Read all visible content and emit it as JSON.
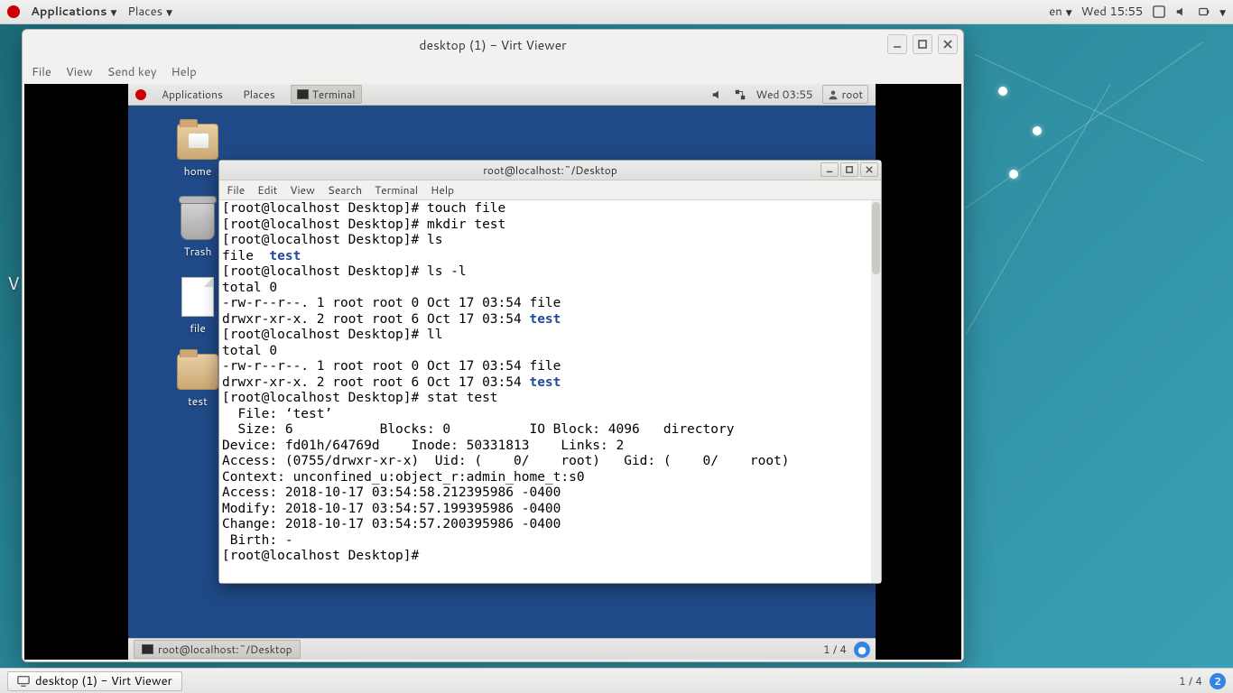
{
  "host_panel": {
    "app_menu": "Applications",
    "places_menu": "Places",
    "lang": "en",
    "clock": "Wed 15:55"
  },
  "host_bottom": {
    "task_label": "desktop (1) - Virt Viewer",
    "pager": "1 / 4",
    "badge": "2"
  },
  "virt": {
    "title": "desktop (1) - Virt Viewer",
    "menus": {
      "file": "File",
      "view": "View",
      "send_key": "Send key",
      "help": "Help"
    }
  },
  "guest_panel": {
    "apps": "Applications",
    "places": "Places",
    "terminal_tab": "Terminal",
    "clock": "Wed 03:55",
    "user": "root"
  },
  "guest_desktop_icons": {
    "home": "home",
    "trash": "Trash",
    "file": "file",
    "test": "test"
  },
  "terminal": {
    "title": "root@localhost:~/Desktop",
    "menus": {
      "file": "File",
      "edit": "Edit",
      "view": "View",
      "search": "Search",
      "terminal": "Terminal",
      "help": "Help"
    },
    "content": {
      "l01": "[root@localhost Desktop]# touch file",
      "l02": "[root@localhost Desktop]# mkdir test",
      "l03": "[root@localhost Desktop]# ls",
      "l04a": "file  ",
      "l04b": "test",
      "l05": "[root@localhost Desktop]# ls -l",
      "l06": "total 0",
      "l07": "-rw-r--r--. 1 root root 0 Oct 17 03:54 file",
      "l08a": "drwxr-xr-x. 2 root root 6 Oct 17 03:54 ",
      "l08b": "test",
      "l09": "[root@localhost Desktop]# ll",
      "l10": "total 0",
      "l11": "-rw-r--r--. 1 root root 0 Oct 17 03:54 file",
      "l12a": "drwxr-xr-x. 2 root root 6 Oct 17 03:54 ",
      "l12b": "test",
      "l13": "[root@localhost Desktop]# stat test",
      "l14": "  File: ‘test’",
      "l15": "  Size: 6           Blocks: 0          IO Block: 4096   directory",
      "l16": "Device: fd01h/64769d    Inode: 50331813    Links: 2",
      "l17": "Access: (0755/drwxr-xr-x)  Uid: (    0/    root)   Gid: (    0/    root)",
      "l18": "Context: unconfined_u:object_r:admin_home_t:s0",
      "l19": "Access: 2018-10-17 03:54:58.212395986 -0400",
      "l20": "Modify: 2018-10-17 03:54:57.199395986 -0400",
      "l21": "Change: 2018-10-17 03:54:57.200395986 -0400",
      "l22": " Birth: -",
      "l23": "[root@localhost Desktop]# "
    }
  },
  "guest_bottom": {
    "task": "root@localhost:~/Desktop",
    "pager": "1 / 4"
  },
  "misc": {
    "hint_v": "V"
  }
}
